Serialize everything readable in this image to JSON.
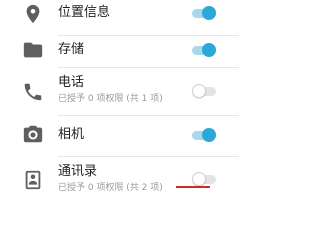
{
  "permissions": [
    {
      "label": "位置信息",
      "sub": "",
      "enabled": true,
      "icon": "location-pin-icon"
    },
    {
      "label": "存储",
      "sub": "",
      "enabled": true,
      "icon": "folder-icon"
    },
    {
      "label": "电话",
      "sub": "已授予 0 项权限 (共 1 项)",
      "enabled": false,
      "icon": "phone-icon"
    },
    {
      "label": "相机",
      "sub": "",
      "enabled": true,
      "icon": "camera-icon"
    },
    {
      "label": "通讯录",
      "sub": "已授予 0 项权限 (共 2 项)",
      "enabled": false,
      "icon": "contacts-icon"
    }
  ],
  "colors": {
    "toggle_on": "#2ba8d8",
    "toggle_on_track": "#a8d8ec",
    "toggle_off_track": "#e3e3e3",
    "icon": "#5f5f5f",
    "annotation_underline": "#d22828"
  }
}
